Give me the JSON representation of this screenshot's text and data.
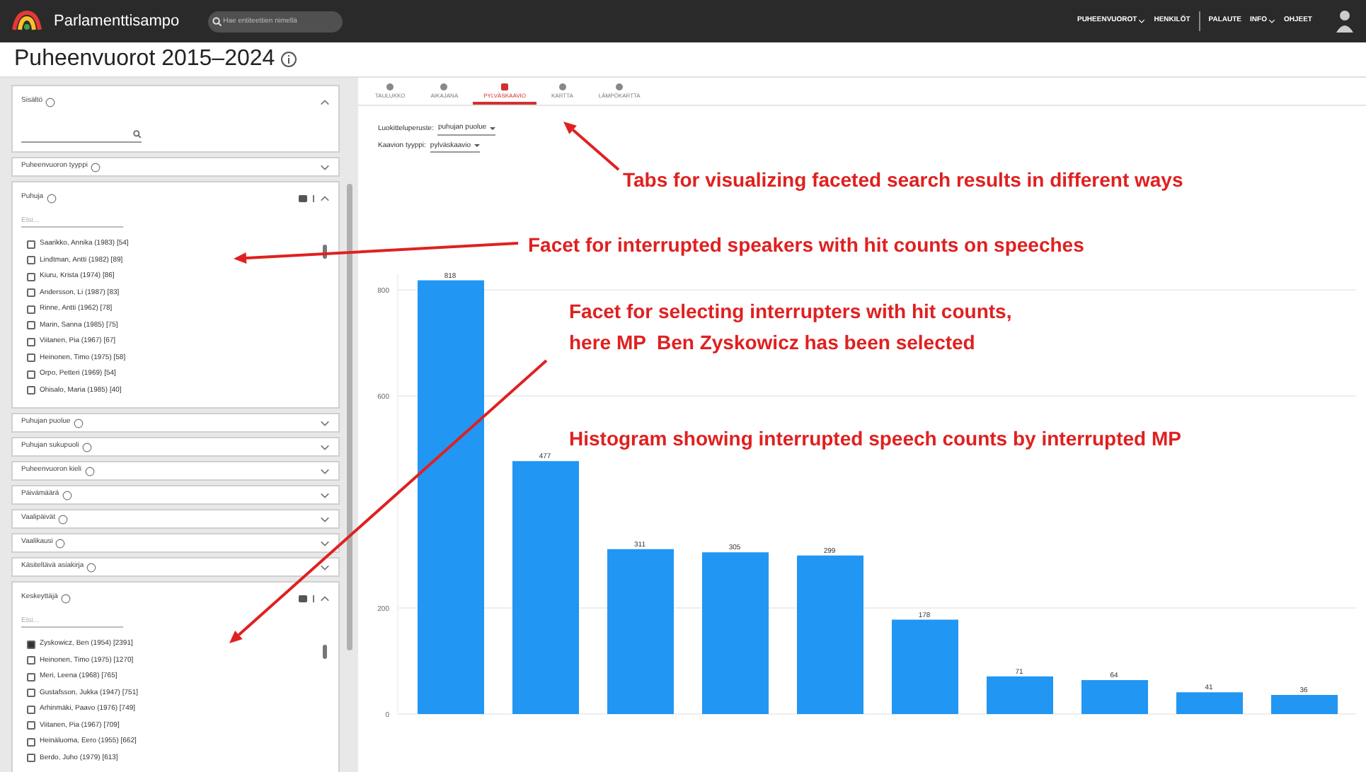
{
  "header": {
    "logo_text": "Parlamenttisampo",
    "search": {
      "placeholder": "Hae entiteettien nimellä"
    },
    "nav": [
      {
        "label": "PUHEENVUOROT",
        "dropdown": true
      },
      {
        "label": "HENKILÖT",
        "dropdown": false
      },
      {
        "label": "PALAUTE",
        "dropdown": false
      },
      {
        "label": "INFO",
        "dropdown": true
      },
      {
        "label": "OHJEET",
        "dropdown": false
      }
    ]
  },
  "page_title": "Puheenvuorot 2015–2024",
  "facets": [
    {
      "label": "Sisältö",
      "kind": "text",
      "expanded": true
    },
    {
      "label": "Puheenvuoron tyyppi",
      "expanded": false
    },
    {
      "label": "Puhuja",
      "kind": "list",
      "expanded": true,
      "filter_placeholder": "Etsi...",
      "items": [
        {
          "label": "Saarikko, Annika (1983) [54]",
          "checked": false
        },
        {
          "label": "Lindtman, Antti (1982) [89]",
          "checked": false
        },
        {
          "label": "Kiuru, Krista (1974) [86]",
          "checked": false
        },
        {
          "label": "Andersson, Li (1987) [83]",
          "checked": false
        },
        {
          "label": "Rinne, Antti (1962) [78]",
          "checked": false
        },
        {
          "label": "Marin, Sanna (1985) [75]",
          "checked": false
        },
        {
          "label": "Viitanen, Pia (1967) [67]",
          "checked": false
        },
        {
          "label": "Heinonen, Timo (1975) [58]",
          "checked": false
        },
        {
          "label": "Orpo, Petteri (1969) [54]",
          "checked": false
        },
        {
          "label": "Ohisalo, Maria (1985) [40]",
          "checked": false
        }
      ]
    },
    {
      "label": "Puhujan puolue",
      "expanded": false
    },
    {
      "label": "Puhujan sukupuoli",
      "expanded": false
    },
    {
      "label": "Puheenvuoron kieli",
      "expanded": false
    },
    {
      "label": "Päivämäärä",
      "expanded": false
    },
    {
      "label": "Vaalipäivät",
      "expanded": false
    },
    {
      "label": "Vaalikausi",
      "expanded": false
    },
    {
      "label": "Käsiteltävä asiakirja",
      "expanded": false
    },
    {
      "label": "Keskeyttäjä",
      "kind": "list",
      "expanded": true,
      "filter_placeholder": "Etsi...",
      "items": [
        {
          "label": "Zyskowicz, Ben (1954) [2391]",
          "checked": true
        },
        {
          "label": "Heinonen, Timo (1975) [1270]",
          "checked": false
        },
        {
          "label": "Meri, Leena (1968) [765]",
          "checked": false
        },
        {
          "label": "Gustafsson, Jukka (1947) [751]",
          "checked": false
        },
        {
          "label": "Arhinmäki, Paavo (1976) [749]",
          "checked": false
        },
        {
          "label": "Viitanen, Pia (1967) [709]",
          "checked": false
        },
        {
          "label": "Heinäluoma, Eero (1955) [662]",
          "checked": false
        },
        {
          "label": "Berdo, Juho (1979) [613]",
          "checked": false
        }
      ]
    }
  ],
  "tabs": [
    {
      "label": "TAULUKKO",
      "selected": false
    },
    {
      "label": "AIKAJANA",
      "selected": false
    },
    {
      "label": "PYLVÄSKAAVIO",
      "selected": true
    },
    {
      "label": "KARTTA",
      "selected": false
    },
    {
      "label": "LÄMPÖKARTTA",
      "selected": false
    }
  ],
  "controls": [
    {
      "label": "Luokitteluperuste:",
      "value": "puhujan puolue"
    },
    {
      "label": "Kaavion tyyppi:",
      "value": "pylväskaavio"
    }
  ],
  "chart_data": {
    "type": "bar",
    "values": [
      818,
      477,
      311,
      305,
      299,
      178,
      71,
      64,
      41,
      36
    ],
    "ylim": [
      0,
      830
    ],
    "yticks": [
      0,
      200,
      600,
      800
    ],
    "grid": true,
    "data_labels": true
  },
  "annotations": [
    {
      "lines": [
        "Tabs for visualizing faceted search results in different ways"
      ]
    },
    {
      "lines": [
        "Facet for interrupted speakers with hit counts on speeches"
      ]
    },
    {
      "lines": [
        "Facet for selecting interrupters with hit counts,",
        "here MP  Ben Zyskowicz has been selected"
      ]
    },
    {
      "lines": [
        "Histogram showing interrupted speech counts by interrupted MP"
      ]
    }
  ]
}
